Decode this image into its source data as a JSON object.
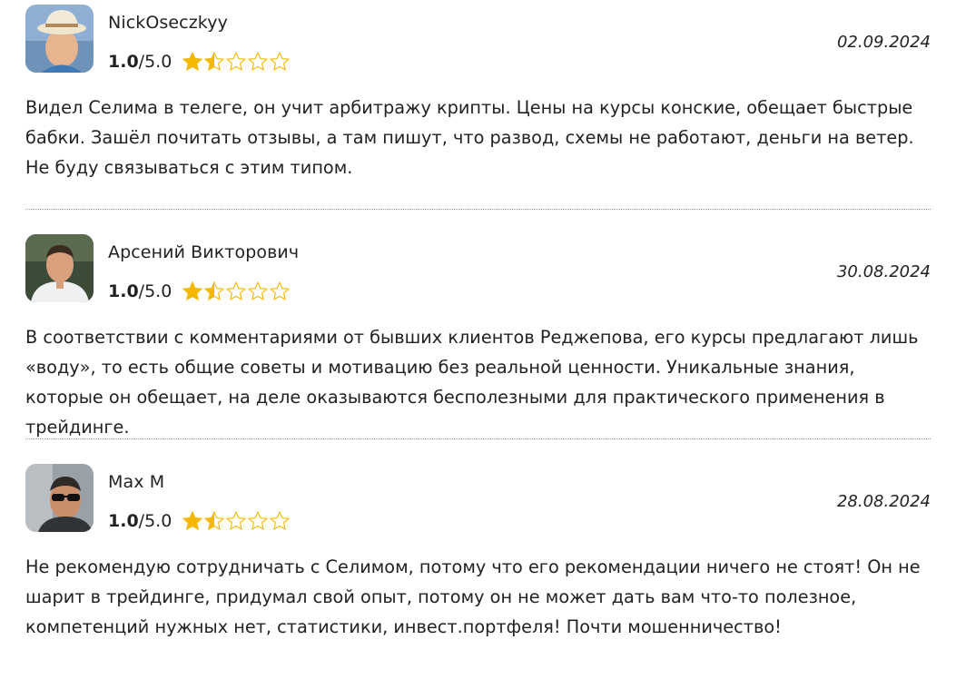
{
  "reviews": [
    {
      "author": "NickOseczkyy",
      "rating_value": "1.0",
      "rating_max": "/5.0",
      "rating": 1.5,
      "date": "02.09.2024",
      "text": "Видел Селима в телеге, он учит арбитражу крипты. Цены на курсы конские, обещает быстрые бабки. Зашёл почитать отзывы, а там пишут, что развод, схемы не работают, деньги на ветер. Не буду связываться с этим типом.",
      "avatar_icon": "user-photo-hat"
    },
    {
      "author": "Арсений Викторович",
      "rating_value": "1.0",
      "rating_max": "/5.0",
      "rating": 1.5,
      "date": "30.08.2024",
      "text": "В соответствии с комментариями от бывших клиентов Реджепова, его курсы предлагают лишь «воду», то есть общие советы и мотивацию без реальной ценности. Уникальные знания, которые он обещает, на деле оказываются бесполезными для практического применения в трейдинге.",
      "avatar_icon": "user-photo-shirt"
    },
    {
      "author": "Max M",
      "rating_value": "1.0",
      "rating_max": "/5.0",
      "rating": 1.5,
      "date": "28.08.2024",
      "text": "Не рекомендую сотрудничать с Селимом, потому что его рекомендации ничего не стоят! Он не шарит в трейдинге, придумал свой опыт, потому он не может дать вам что-то полезное, компетенций нужных нет, статистики, инвест.портфеля! Почти мошенничество!",
      "avatar_icon": "user-photo-sunglasses"
    }
  ],
  "colors": {
    "star_fill": "#f5b800",
    "star_outline": "#f5b800",
    "divider": "#9a9a9a",
    "text": "#222222"
  }
}
